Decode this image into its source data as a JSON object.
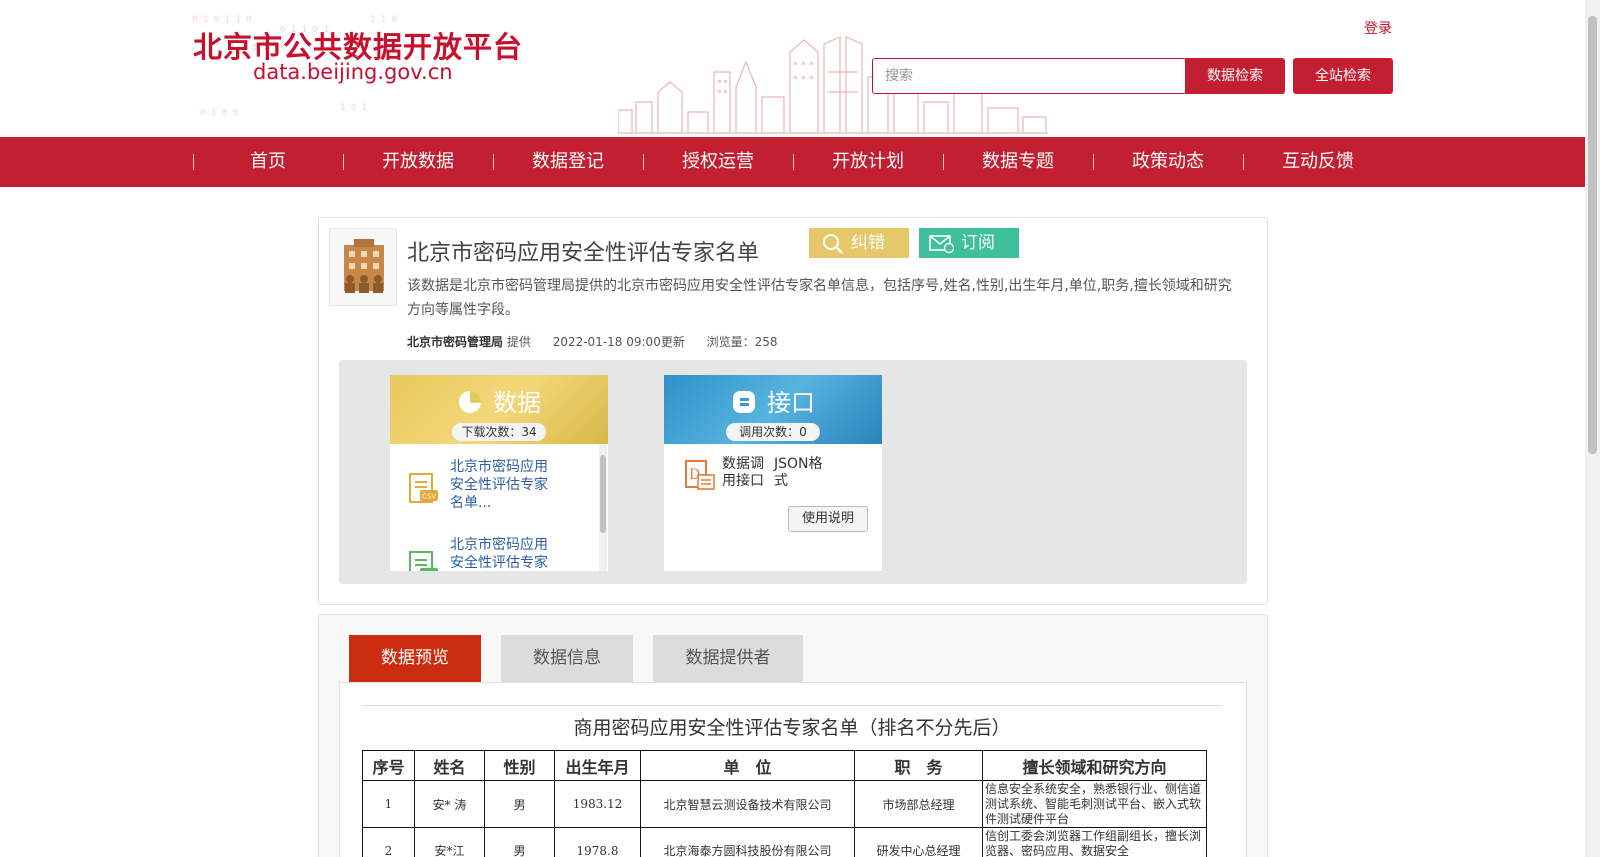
{
  "header": {
    "site_title": "北京市公共数据开放平台",
    "site_url": "data.beijing.gov.cn",
    "login": "登录",
    "search_placeholder": "搜索",
    "data_search": "数据检索",
    "site_search": "全站检索"
  },
  "nav": {
    "items": [
      "首页",
      "开放数据",
      "数据登记",
      "授权运营",
      "开放计划",
      "数据专题",
      "政策动态",
      "互动反馈"
    ]
  },
  "dataset": {
    "title": "北京市密码应用安全性评估专家名单",
    "correct_label": "纠错",
    "subscribe_label": "订阅",
    "description": "该数据是北京市密码管理局提供的北京市密码应用安全性评估专家名单信息，包括序号,姓名,性别,出生年月,单位,职务,擅长领域和研究方向等属性字段。",
    "provider": "北京市密码管理局",
    "provider_suffix": "提供",
    "updated": "2022-01-18 09:00更新",
    "views": "浏览量：258"
  },
  "resources": {
    "data": {
      "title": "数据",
      "count": "下载次数：34",
      "files": [
        {
          "name": "北京市密码应用安全性评估专家名单...",
          "type": "CSV"
        },
        {
          "name": "北京市密码应用安全性评估专家",
          "type": "XLS"
        }
      ]
    },
    "api": {
      "title": "接口",
      "count": "调用次数：0",
      "label": "数据调用接口",
      "format": "JSON格式",
      "usage_button": "使用说明"
    }
  },
  "tabs": {
    "preview": "数据预览",
    "info": "数据信息",
    "provider": "数据提供者"
  },
  "sheet": {
    "title": "商用密码应用安全性评估专家名单（排名不分先后）",
    "headers": [
      "序号",
      "姓名",
      "性别",
      "出生年月",
      "单　位",
      "职　务",
      "擅长领域和研究方向"
    ],
    "rows": [
      [
        "1",
        "安* 涛",
        "男",
        "1983.12",
        "北京智慧云测设备技术有限公司",
        "市场部总经理",
        "信息安全系统安全，熟悉银行业、侧信道测试系统、智能毛刺测试平台、嵌入式软件测试硬件平台"
      ],
      [
        "2",
        "安*江",
        "男",
        "1978.8",
        "北京海泰方圆科技股份有限公司",
        "研发中心总经理",
        "信创工委会浏览器工作组副组长，擅长浏览器、密码应用、数据安全"
      ]
    ]
  },
  "colors": {
    "brand_red": "#c21f32",
    "correct_yellow": "#e6c86a",
    "subscribe_green": "#3fbf9c",
    "tab_active": "#cc2c11"
  }
}
